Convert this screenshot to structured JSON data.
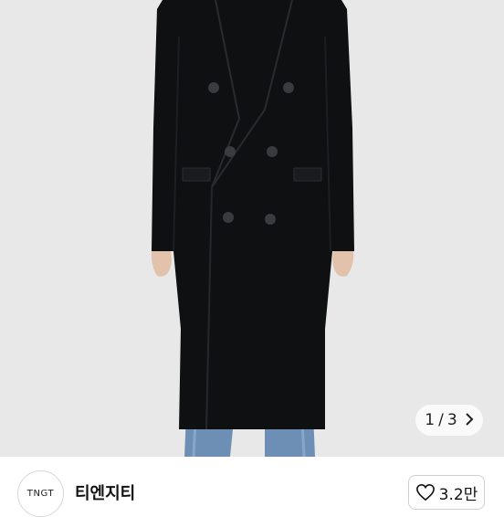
{
  "gallery": {
    "current": "1",
    "separator": "/",
    "total": "3",
    "next_icon": "chevron-right-icon"
  },
  "shop": {
    "avatar_text": "TNGT",
    "name": "티엔지티"
  },
  "like": {
    "icon": "heart-outline-icon",
    "count": "3.2만"
  },
  "colors": {
    "background": "#e9e9e9",
    "coat": "#0f1012",
    "jeans": "#6d8fb6"
  }
}
